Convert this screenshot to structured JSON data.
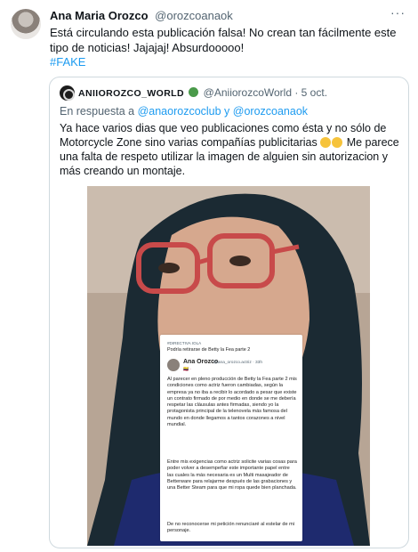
{
  "tweet": {
    "author_name": "Ana Maria Orozco",
    "author_handle": "@orozcoanaok",
    "more_icon": "···",
    "text": "Está circulando esta publicación falsa! No crean tan fácilmente este tipo de noticias! Jajajaj! Absurdooooo!",
    "hashtag": "#FAKE"
  },
  "quote": {
    "author_name": "ANIIOROZCO_WORLD",
    "author_handle": "@AniiorozcoWorld",
    "date": "· 5 oct.",
    "reply_prefix": "En respuesta a",
    "reply_handles": "@anaorozcoclub y @orozcoanaok",
    "text": "Ya hace varios dias que veo publicaciones como ésta y no sólo de Motorcycle Zone sino varias compañías publicitarias",
    "text_tail": "Me parece una falta de respeto utilizar la imagen de alguien sin autorizacion y más creando un montaje."
  },
  "inner_card": {
    "tag": "#DIRECTIVA IOLA",
    "title": "Podría retirarse de Betty la Fea parte 2",
    "name": "Ana Orozco",
    "handle": "@ana_orozco.actriz · 33h",
    "flags": "🇨🇴 ·",
    "paragraph_1": "Al parecer en pleno producción de Betty la Fea parte 2 mis condiciones como actriz fueron cambiadas, según la empresa ya no iba a recibir lo acordado a pesar que existe un contrato firmado de por medio en donde se me debería respetar las cláusulas antes firmadas, siendo yo la protagonista principal de la telenovela más famosa del mundo en donde llegamos a tantos corazones a nivel mundial.",
    "paragraph_2": "Entre mis exigencias como actriz solicite varias cosas para poder volver a desempeñar este importante papel entre las cuales la más necesaria es un Multi masajeador de Betterware para relajarme después de las grabaciones y una Better Steam para que mi ropa quede bien planchada.",
    "paragraph_3": "De no reconocerse mi petición renunciaré al estelar de mi personaje."
  },
  "colors": {
    "link": "#1d9bf0",
    "muted": "#536471",
    "border": "#cfd9de"
  }
}
